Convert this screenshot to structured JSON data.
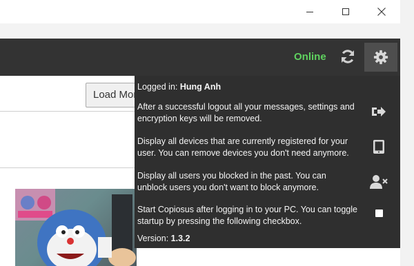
{
  "window": {
    "minimize_icon": "minimize-icon",
    "maximize_icon": "maximize-icon",
    "close_icon": "close-icon"
  },
  "header": {
    "status": "Online",
    "status_color": "#5fd25f",
    "refresh_icon": "refresh-icon",
    "settings_icon": "gear-icon"
  },
  "content": {
    "load_more_label": "Load More"
  },
  "settings_panel": {
    "logged_in_prefix": "Logged in: ",
    "username": "Hung Anh",
    "logout_text": "After a successful logout all your messages, settings and encryption keys will be removed.",
    "devices_text": "Display all devices that are currently registered for your user. You can remove devices you don't need anymore.",
    "blocked_text": "Display all users you blocked in the past. You can unblock users you don't want to block anymore.",
    "startup_text": "Start Copiosus after logging in to your PC. You can toggle startup by pressing the following checkbox.",
    "version_prefix": "Version: ",
    "version": "1.3.2",
    "icons": [
      "logout-icon",
      "tablet-icon",
      "user-block-icon",
      "checkbox"
    ]
  }
}
